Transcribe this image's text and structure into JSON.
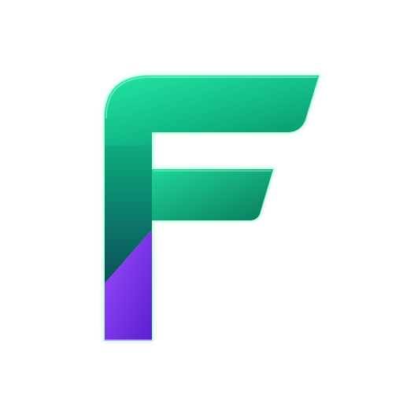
{
  "app_icon": {
    "glyph": "F",
    "icon_name": "letter-f-logo-icon",
    "colors": {
      "background": "#ffffff",
      "green_light": "#22E8A6",
      "green_mid": "#10B985",
      "green_dark": "#0A7B5C",
      "teal_deep": "#0B4F5A",
      "purple_light": "#9B4DFF",
      "purple_dark": "#5A1FD1",
      "glow": "#7CF7C6",
      "purple_glow": "#B58CFF"
    }
  }
}
